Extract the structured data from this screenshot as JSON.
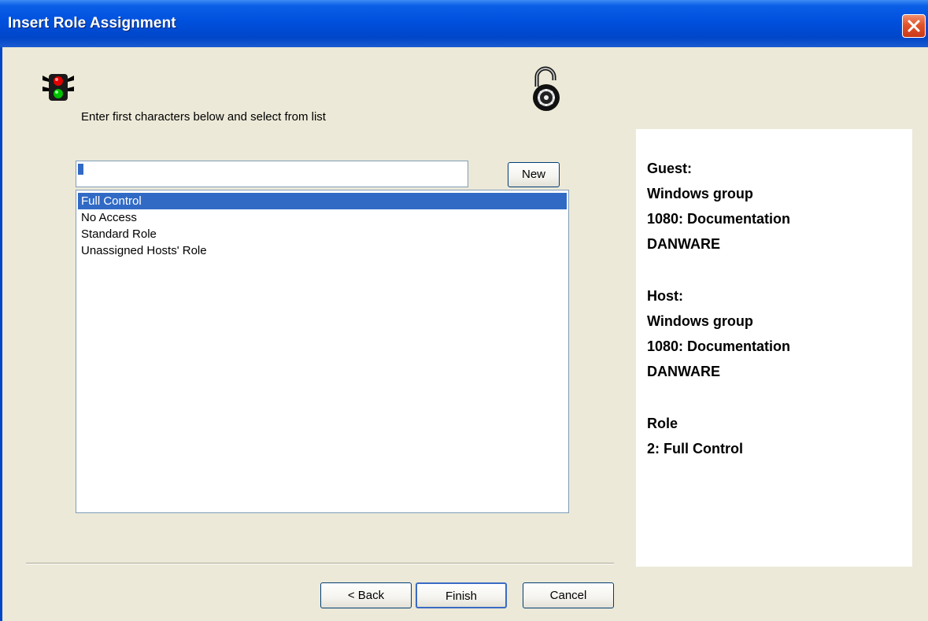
{
  "window": {
    "title": "Insert Role Assignment"
  },
  "instruction": "Enter first characters below and select from list",
  "search": {
    "value": ""
  },
  "buttons": {
    "new": "New",
    "back": "< Back",
    "finish": "Finish",
    "cancel": "Cancel"
  },
  "roles": [
    {
      "label": "Full Control",
      "selected": true
    },
    {
      "label": "No Access",
      "selected": false
    },
    {
      "label": "Standard Role",
      "selected": false
    },
    {
      "label": "Unassigned Hosts' Role",
      "selected": false
    }
  ],
  "info": {
    "guest": {
      "heading": "Guest:",
      "type": "Windows group",
      "id": "1080: Documentation",
      "domain": "DANWARE"
    },
    "host": {
      "heading": "Host:",
      "type": "Windows group",
      "id": "1080: Documentation",
      "domain": "DANWARE"
    },
    "role": {
      "heading": "Role",
      "value": "2: Full Control"
    }
  },
  "icons": {
    "traffic": "traffic-light-icon",
    "lock": "padlock-icon",
    "close": "close-icon"
  },
  "colors": {
    "titlebar": "#0050DE",
    "selection": "#316AC5",
    "dialog_bg": "#ECE9D8",
    "close_button": "#E1542A"
  }
}
